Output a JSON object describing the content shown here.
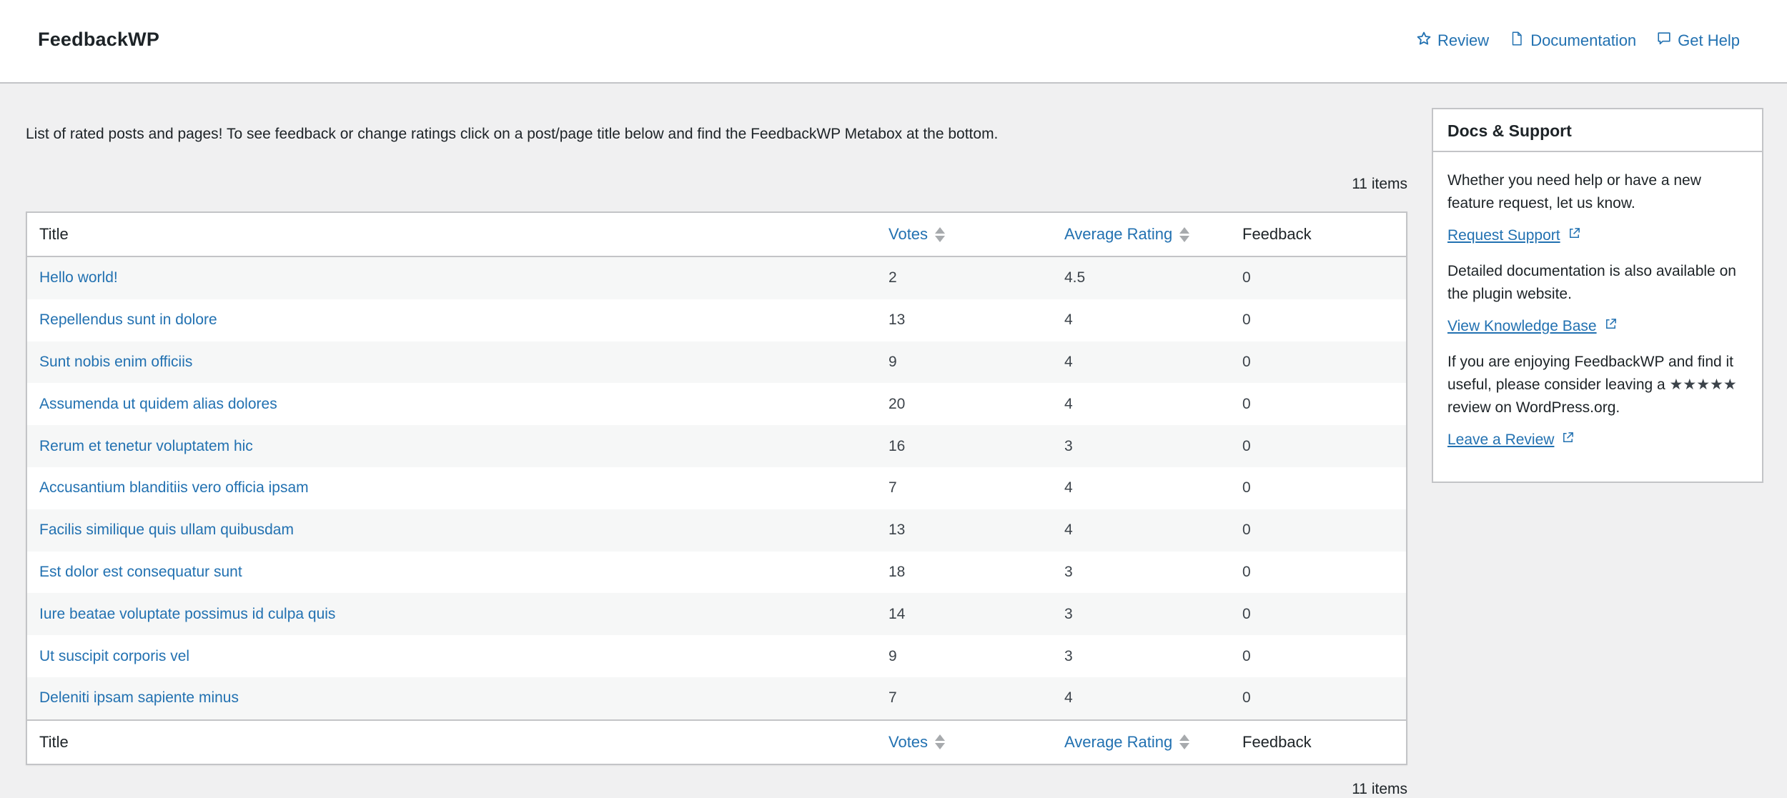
{
  "header": {
    "title": "FeedbackWP",
    "links": [
      {
        "label": "Review",
        "icon": "star-outline-icon"
      },
      {
        "label": "Documentation",
        "icon": "document-icon"
      },
      {
        "label": "Get Help",
        "icon": "speech-bubble-icon"
      }
    ]
  },
  "intro": "List of rated posts and pages! To see feedback or change ratings click on a post/page title below and find the FeedbackWP Metabox at the bottom.",
  "item_count": "11 items",
  "table": {
    "columns": [
      {
        "label": "Title",
        "sortable": false
      },
      {
        "label": "Votes",
        "sortable": true
      },
      {
        "label": "Average Rating",
        "sortable": true
      },
      {
        "label": "Feedback",
        "sortable": false
      }
    ],
    "rows": [
      {
        "title": "Hello world!",
        "votes": "2",
        "rating": "4.5",
        "feedback": "0"
      },
      {
        "title": "Repellendus sunt in dolore",
        "votes": "13",
        "rating": "4",
        "feedback": "0"
      },
      {
        "title": "Sunt nobis enim officiis",
        "votes": "9",
        "rating": "4",
        "feedback": "0"
      },
      {
        "title": "Assumenda ut quidem alias dolores",
        "votes": "20",
        "rating": "4",
        "feedback": "0"
      },
      {
        "title": "Rerum et tenetur voluptatem hic",
        "votes": "16",
        "rating": "3",
        "feedback": "0"
      },
      {
        "title": "Accusantium blanditiis vero officia ipsam",
        "votes": "7",
        "rating": "4",
        "feedback": "0"
      },
      {
        "title": "Facilis similique quis ullam quibusdam",
        "votes": "13",
        "rating": "4",
        "feedback": "0"
      },
      {
        "title": "Est dolor est consequatur sunt",
        "votes": "18",
        "rating": "3",
        "feedback": "0"
      },
      {
        "title": "Iure beatae voluptate possimus id culpa quis",
        "votes": "14",
        "rating": "3",
        "feedback": "0"
      },
      {
        "title": "Ut suscipit corporis vel",
        "votes": "9",
        "rating": "3",
        "feedback": "0"
      },
      {
        "title": "Deleniti ipsam sapiente minus",
        "votes": "7",
        "rating": "4",
        "feedback": "0"
      }
    ]
  },
  "sidebar": {
    "title": "Docs & Support",
    "help_text": "Whether you need help or have a new feature request, let us know.",
    "request_support_label": "Request Support",
    "docs_text": "Detailed documentation is also available on the plugin website.",
    "knowledge_base_label": "View Knowledge Base",
    "review_text_before": "If you are enjoying FeedbackWP and find it useful, please consider leaving a",
    "review_stars": "★★★★★",
    "review_text_after": "review on WordPress.org.",
    "leave_review_label": "Leave a Review"
  },
  "colors": {
    "link": "#2271b1",
    "background": "#f0f0f1",
    "border": "#c3c4c7",
    "row_stripe": "#f6f7f7"
  }
}
